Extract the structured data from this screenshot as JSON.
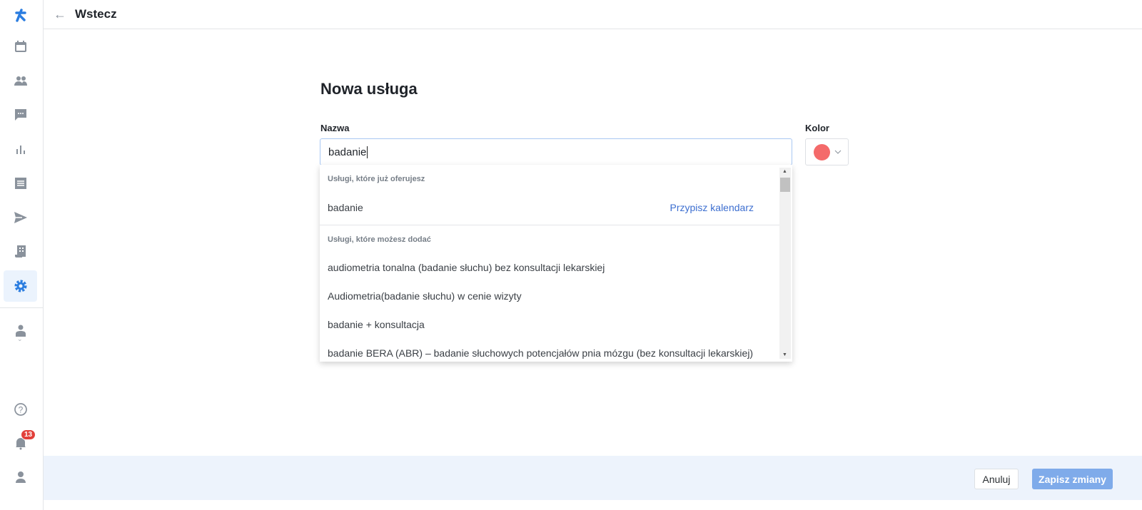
{
  "header": {
    "back_label": "Wstecz"
  },
  "page_title": "Nowa usługa",
  "form": {
    "name_label": "Nazwa",
    "name_value": "badanie",
    "color_label": "Kolor",
    "color_value": "#f46a6a"
  },
  "dropdown": {
    "existing_header": "Usługi, które już oferujesz",
    "existing": [
      {
        "label": "badanie",
        "action": "Przypisz kalendarz"
      }
    ],
    "available_header": "Usługi, które możesz dodać",
    "available": [
      "audiometria tonalna (badanie słuchu) bez konsultacji lekarskiej",
      "Audiometria(badanie słuchu) w cenie wizyty",
      "badanie + konsultacja",
      "badanie BERA (ABR) – badanie słuchowych potencjałów pnia mózgu (bez konsultacji lekarskiej)"
    ]
  },
  "sidebar": {
    "notifications_count": "13"
  },
  "footer": {
    "cancel_label": "Anuluj",
    "save_label": "Zapisz zmiany"
  },
  "colors": {
    "accent": "#2b7de0",
    "footer_bg": "#edf3fc",
    "badge": "#e2403a"
  }
}
